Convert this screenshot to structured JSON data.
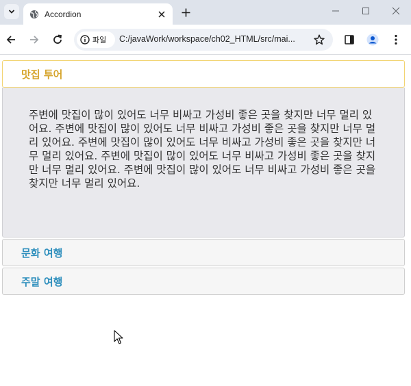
{
  "browser": {
    "tab_title": "Accordion",
    "site_info_label": "파일",
    "url": "C:/javaWork/workspace/ch02_HTML/src/mai..."
  },
  "accordion": {
    "sections": [
      {
        "title": "맛집 투어",
        "expanded": true,
        "content": "주변에 맛집이 많이 있어도 너무 비싸고 가성비 좋은 곳을 찾지만 너무 멀리 있어요. 주변에 맛집이 많이 있어도 너무 비싸고 가성비 좋은 곳을 찾지만 너무 멀리 있어요. 주변에 맛집이 많이 있어도 너무 비싸고 가성비 좋은 곳을 찾지만 너무 멀리 있어요. 주변에 맛집이 많이 있어도 너무 비싸고 가성비 좋은 곳을 찾지만 너무 멀리 있어요. 주변에 맛집이 많이 있어도 너무 비싸고 가성비 좋은 곳을 찾지만 너무 멀리 있어요."
      },
      {
        "title": "문화 여행",
        "expanded": false
      },
      {
        "title": "주말 여행",
        "expanded": false
      }
    ]
  },
  "colors": {
    "active_header_text": "#d6a52d",
    "active_header_border": "#f2d472",
    "collapsed_header_text": "#2f8fbd",
    "panel_background": "#e9e9ed"
  },
  "icons": [
    "tab-search-icon",
    "globe-icon",
    "close-icon",
    "plus-icon",
    "minimize-icon",
    "maximize-icon",
    "window-close-icon",
    "back-arrow-icon",
    "forward-arrow-icon",
    "reload-icon",
    "info-icon",
    "star-icon",
    "side-panel-icon",
    "profile-icon",
    "menu-dots-icon",
    "mouse-cursor-icon"
  ]
}
